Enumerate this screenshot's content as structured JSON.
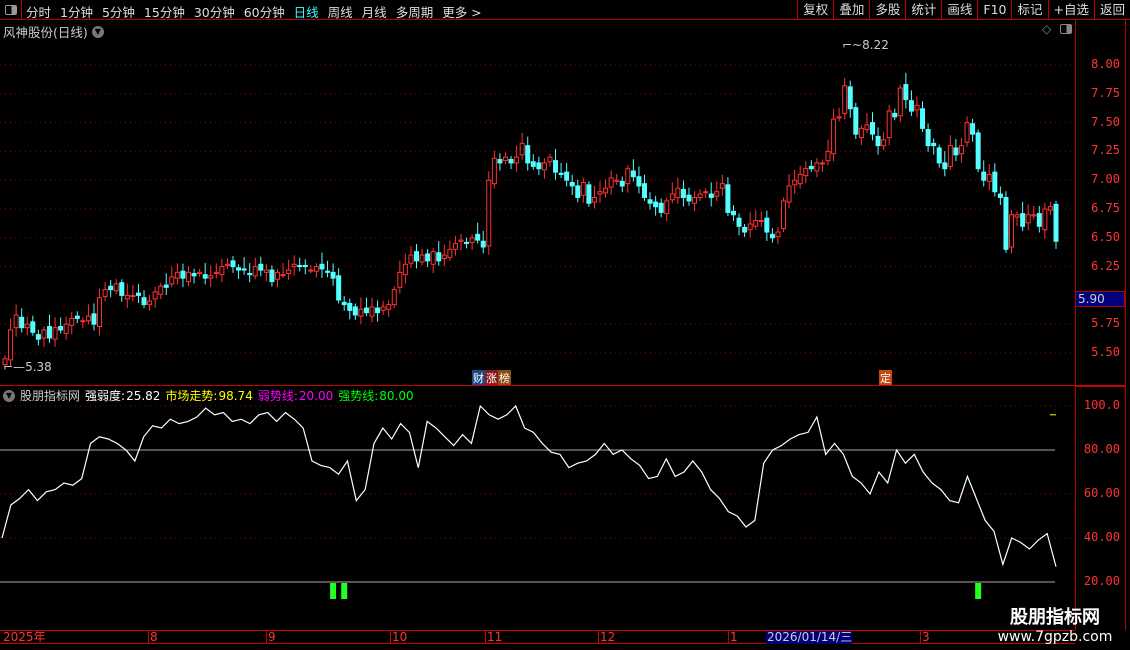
{
  "toolbar": {
    "periods": [
      "分时",
      "1分钟",
      "5分钟",
      "15分钟",
      "30分钟",
      "60分钟",
      "日线",
      "周线",
      "月线",
      "多周期",
      "更多 >"
    ],
    "active_period": "日线",
    "buttons": [
      "复权",
      "叠加",
      "多股",
      "统计",
      "画线",
      "F10",
      "标记",
      "+自选",
      "返回"
    ]
  },
  "chart": {
    "title": "风神股份(日线)",
    "max_label": "8.22",
    "min_label": "5.38",
    "current_price": "5.90",
    "price_ticks": [
      "8.00",
      "7.75",
      "7.50",
      "7.25",
      "7.00",
      "6.75",
      "6.50",
      "6.25",
      "5.75",
      "5.50"
    ],
    "tags": [
      "财",
      "涨",
      "榜",
      "定"
    ]
  },
  "indicator": {
    "name": "股朋指标网",
    "strength_label": "强弱度:",
    "strength_value": "25.82",
    "market_label": "市场走势:",
    "market_value": "98.74",
    "weak_label": "弱势线:",
    "weak_value": "20.00",
    "strong_label": "强势线:",
    "strong_value": "80.00",
    "ticks": [
      "100.0",
      "80.00",
      "60.00",
      "40.00",
      "20.00"
    ]
  },
  "date_axis": {
    "labels": [
      "2025年",
      "8",
      "9",
      "10",
      "11",
      "12",
      "1",
      "3"
    ],
    "cursor_date": "2026/01/14/三"
  },
  "watermark": {
    "name": "股朋指标网",
    "url": "www.7gpzb.com"
  },
  "colors": {
    "up": "#ff3232",
    "down": "#54ffff",
    "weak": "#ff00ff",
    "strong": "#00ff00",
    "market": "#ffff00"
  },
  "chart_data": {
    "type": "candlestick",
    "closes": [
      5.45,
      5.7,
      5.83,
      5.72,
      5.75,
      5.68,
      5.62,
      5.7,
      5.63,
      5.72,
      5.7,
      5.75,
      5.8,
      5.8,
      5.78,
      5.82,
      5.75,
      5.98,
      6.05,
      6.05,
      6.1,
      6.0,
      6.0,
      6.0,
      6.0,
      5.92,
      5.95,
      6.03,
      6.08,
      6.07,
      6.16,
      6.2,
      6.15,
      6.2,
      6.17,
      6.2,
      6.15,
      6.17,
      6.2,
      6.25,
      6.27,
      6.25,
      6.22,
      6.22,
      6.18,
      6.25,
      6.22,
      6.22,
      6.12,
      6.2,
      6.18,
      6.22,
      6.27,
      6.25,
      6.25,
      6.22,
      6.25,
      6.23,
      6.2,
      6.15,
      5.96,
      5.92,
      5.87,
      5.83,
      5.88,
      5.85,
      5.9,
      5.85,
      5.9,
      5.92,
      6.05,
      6.2,
      6.27,
      6.35,
      6.3,
      6.35,
      6.3,
      6.38,
      6.3,
      6.35,
      6.4,
      6.45,
      6.48,
      6.45,
      6.5,
      6.48,
      6.42,
      7.0,
      7.19,
      7.15,
      7.2,
      7.15,
      7.2,
      7.32,
      7.15,
      7.12,
      7.1,
      7.15,
      7.2,
      7.07,
      7.05,
      7.0,
      6.95,
      6.85,
      6.98,
      6.8,
      6.85,
      6.9,
      6.93,
      7.02,
      7.0,
      6.95,
      7.1,
      7.03,
      6.95,
      6.85,
      6.8,
      6.77,
      6.72,
      6.82,
      6.88,
      6.93,
      6.85,
      6.82,
      6.85,
      6.88,
      6.9,
      6.85,
      6.9,
      6.97,
      6.72,
      6.7,
      6.6,
      6.55,
      6.62,
      6.65,
      6.65,
      6.55,
      6.5,
      6.55,
      6.82,
      6.95,
      7.0,
      7.05,
      7.1,
      7.1,
      7.15,
      7.15,
      7.25,
      7.53,
      7.55,
      7.82,
      7.62,
      7.4,
      7.45,
      7.48,
      7.4,
      7.3,
      7.35,
      7.6,
      7.55,
      7.8,
      7.7,
      7.6,
      7.65,
      7.45,
      7.3,
      7.3,
      7.15,
      7.1,
      7.3,
      7.22,
      7.3,
      7.5,
      7.4,
      7.1,
      7.0,
      7.05,
      6.9,
      6.85,
      6.4,
      6.7,
      6.7,
      6.6,
      6.7,
      6.7,
      6.6,
      6.75,
      6.77,
      6.47
    ],
    "first_open": 5.4,
    "high": 8.22,
    "low": 5.38,
    "ylim": [
      5.3,
      8.3
    ],
    "indicator_values": [
      40,
      55,
      58,
      62,
      57,
      61,
      62,
      65,
      64,
      67,
      83,
      86,
      85,
      83,
      80,
      75,
      86,
      91,
      90,
      94,
      92,
      93,
      95,
      99,
      96,
      97,
      93,
      94,
      92,
      96,
      97,
      93,
      97,
      94,
      90,
      75,
      73,
      72,
      69,
      75,
      57,
      62,
      83,
      90,
      85,
      92,
      88,
      72,
      93,
      90,
      86,
      82,
      87,
      83,
      100,
      96,
      94,
      96,
      100,
      90,
      88,
      83,
      79,
      78,
      72,
      74,
      75,
      78,
      83,
      78,
      80,
      76,
      73,
      67,
      68,
      76,
      68,
      70,
      75,
      70,
      62,
      58,
      52,
      50,
      45,
      48,
      74,
      80,
      82,
      85,
      87,
      88,
      95,
      78,
      83,
      78,
      68,
      65,
      60,
      70,
      65,
      80,
      74,
      78,
      70,
      65,
      62,
      57,
      56,
      68,
      58,
      48,
      43,
      28,
      40,
      38,
      35,
      39,
      42,
      27
    ],
    "indicator_ylim": [
      20,
      100
    ],
    "signal_bars": [
      59,
      61,
      175
    ]
  }
}
